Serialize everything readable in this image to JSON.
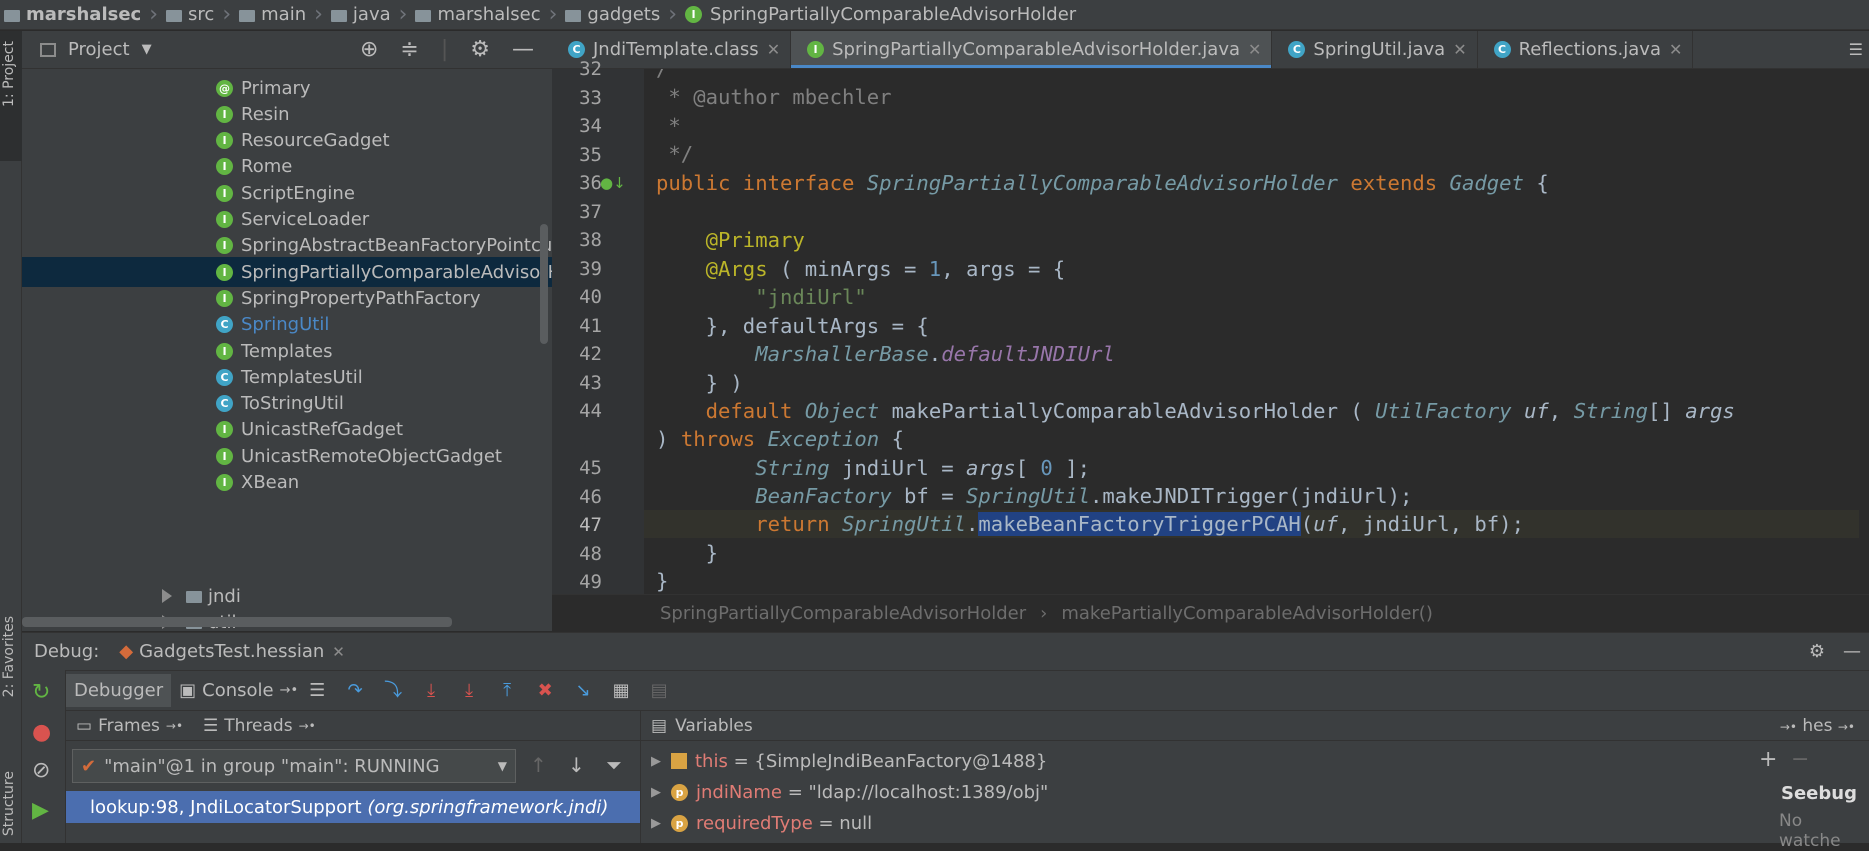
{
  "breadcrumb": [
    "marshalsec",
    "src",
    "main",
    "java",
    "marshalsec",
    "gadgets",
    "SpringPartiallyComparableAdvisorHolder"
  ],
  "left_toolbar": {
    "project": "1: Project",
    "favorites": "2: Favorites",
    "structure": "Structure"
  },
  "project_panel": {
    "title": "Project",
    "items": [
      {
        "label": "Primary",
        "icon": "annotation-icon",
        "kind": "a"
      },
      {
        "label": "Resin",
        "icon": "interface-icon",
        "kind": "i"
      },
      {
        "label": "ResourceGadget",
        "icon": "interface-icon",
        "kind": "i"
      },
      {
        "label": "Rome",
        "icon": "interface-icon",
        "kind": "i"
      },
      {
        "label": "ScriptEngine",
        "icon": "interface-icon",
        "kind": "i"
      },
      {
        "label": "ServiceLoader",
        "icon": "interface-icon",
        "kind": "i"
      },
      {
        "label": "SpringAbstractBeanFactoryPointcut",
        "icon": "interface-icon",
        "kind": "i"
      },
      {
        "label": "SpringPartiallyComparableAdvisorHolder",
        "icon": "interface-icon",
        "kind": "i",
        "selected": true
      },
      {
        "label": "SpringPropertyPathFactory",
        "icon": "interface-icon",
        "kind": "i"
      },
      {
        "label": "SpringUtil",
        "icon": "class-icon",
        "kind": "c"
      },
      {
        "label": "Templates",
        "icon": "interface-icon",
        "kind": "i"
      },
      {
        "label": "TemplatesUtil",
        "icon": "class-icon",
        "kind": "c"
      },
      {
        "label": "ToStringUtil",
        "icon": "class-icon",
        "kind": "c"
      },
      {
        "label": "UnicastRefGadget",
        "icon": "interface-icon",
        "kind": "i"
      },
      {
        "label": "UnicastRemoteObjectGadget",
        "icon": "interface-icon",
        "kind": "i"
      },
      {
        "label": "XBean",
        "icon": "interface-icon",
        "kind": "i"
      }
    ],
    "folders": [
      "jndi",
      "util"
    ]
  },
  "tabs": [
    {
      "label": "JndiTemplate.class",
      "icon": "class-icon",
      "kind": "c"
    },
    {
      "label": "SpringPartiallyComparableAdvisorHolder.java",
      "icon": "interface-icon",
      "kind": "i",
      "active": true
    },
    {
      "label": "SpringUtil.java",
      "icon": "class-icon",
      "kind": "c"
    },
    {
      "label": "Reflections.java",
      "icon": "class-icon",
      "kind": "c"
    }
  ],
  "editor": {
    "line_numbers": [
      "32",
      "33",
      "34",
      "35",
      "36",
      "37",
      "38",
      "39",
      "40",
      "41",
      "42",
      "43",
      "44",
      "",
      "45",
      "46",
      "47",
      "48",
      "49"
    ],
    "current_line": "47"
  },
  "editor_breadcrumb": [
    "SpringPartiallyComparableAdvisorHolder",
    "makePartiallyComparableAdvisorHolder()"
  ],
  "debug": {
    "label": "Debug:",
    "session": "GadgetsTest.hessian",
    "tabs": [
      "Debugger",
      "Console"
    ],
    "frames_tab": "Frames",
    "threads_tab": "Threads",
    "thread_select": "\"main\"@1 in group \"main\": RUNNING",
    "frame_selected": "lookup:98, JndiLocatorSupport",
    "frame_selected_pkg": "(org.springframework.jndi)",
    "variables_title": "Variables",
    "variables_right": "hes",
    "variables": [
      {
        "name": "this",
        "value": "= {SimpleJndiBeanFactory@1488}",
        "icon": "field-icon"
      },
      {
        "name": "jndiName",
        "value": "= \"ldap://localhost:1389/obj\"",
        "icon": "param-icon"
      },
      {
        "name": "requiredType",
        "value": "= null",
        "icon": "param-icon"
      }
    ],
    "no_watches": "No watche"
  },
  "watermark": "Seebug"
}
